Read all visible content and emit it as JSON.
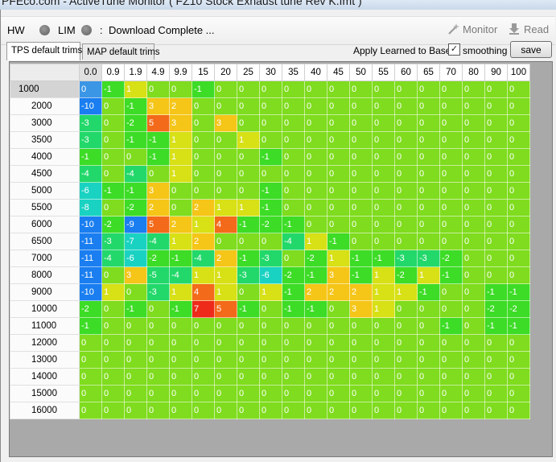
{
  "window": {
    "title": "PFEco.com - ActiveTune Monitor   ( FZ10 Stock Exhaust tune Rev K.fmt )"
  },
  "toolbar": {
    "hw_label": "HW",
    "lim_label": "LIM",
    "status_separator": ":",
    "status_text": "Download Complete  ...",
    "monitor_label": "Monitor",
    "read_label": "Read"
  },
  "tabs": [
    {
      "label": "TPS default trims",
      "active": true
    },
    {
      "label": "MAP default trims",
      "active": false
    }
  ],
  "options": {
    "apply_label": "Apply Learned to Base:",
    "smoothing_checked": true,
    "smoothing_label": "smoothing",
    "save_label": "save"
  },
  "grid": {
    "columns": [
      "0.0",
      "0.9",
      "1.9",
      "4.9",
      "9.9",
      "15",
      "20",
      "25",
      "30",
      "35",
      "40",
      "45",
      "50",
      "55",
      "60",
      "65",
      "70",
      "80",
      "90",
      "100"
    ],
    "rows": [
      "1000",
      "2000",
      "3000",
      "3500",
      "4000",
      "4500",
      "5000",
      "5500",
      "6000",
      "6500",
      "7000",
      "8000",
      "9000",
      "10000",
      "11000",
      "12000",
      "13000",
      "14000",
      "15000",
      "16000"
    ],
    "values": [
      [
        0,
        -1,
        1,
        0,
        0,
        -1,
        0,
        0,
        0,
        0,
        0,
        0,
        0,
        0,
        0,
        0,
        0,
        0,
        0,
        0
      ],
      [
        -10,
        0,
        -1,
        3,
        2,
        0,
        0,
        0,
        0,
        0,
        0,
        0,
        0,
        0,
        0,
        0,
        0,
        0,
        0,
        0
      ],
      [
        -3,
        0,
        -2,
        5,
        3,
        0,
        3,
        0,
        0,
        0,
        0,
        0,
        0,
        0,
        0,
        0,
        0,
        0,
        0,
        0
      ],
      [
        -3,
        0,
        -1,
        -1,
        1,
        0,
        0,
        1,
        0,
        0,
        0,
        0,
        0,
        0,
        0,
        0,
        0,
        0,
        0,
        0
      ],
      [
        -1,
        0,
        0,
        -1,
        1,
        0,
        0,
        0,
        -1,
        0,
        0,
        0,
        0,
        0,
        0,
        0,
        0,
        0,
        0,
        0
      ],
      [
        -4,
        0,
        -4,
        0,
        1,
        0,
        0,
        0,
        0,
        0,
        0,
        0,
        0,
        0,
        0,
        0,
        0,
        0,
        0,
        0
      ],
      [
        -6,
        -1,
        -1,
        3,
        0,
        0,
        0,
        0,
        -1,
        0,
        0,
        0,
        0,
        0,
        0,
        0,
        0,
        0,
        0,
        0
      ],
      [
        -8,
        0,
        -2,
        2,
        0,
        2,
        1,
        1,
        -1,
        0,
        0,
        0,
        0,
        0,
        0,
        0,
        0,
        0,
        0,
        0
      ],
      [
        -10,
        -2,
        -9,
        5,
        2,
        1,
        4,
        -1,
        -2,
        -1,
        0,
        0,
        0,
        0,
        0,
        0,
        0,
        0,
        0,
        0
      ],
      [
        -11,
        -3,
        -7,
        -4,
        1,
        2,
        0,
        0,
        0,
        -4,
        1,
        -1,
        0,
        0,
        0,
        0,
        0,
        0,
        0,
        0
      ],
      [
        -11,
        -4,
        -6,
        -2,
        -1,
        -4,
        2,
        -1,
        -3,
        0,
        -2,
        1,
        -1,
        -1,
        -3,
        -3,
        -2,
        0,
        0,
        0
      ],
      [
        -11,
        0,
        3,
        -5,
        -4,
        1,
        1,
        -3,
        -6,
        -2,
        -1,
        3,
        -1,
        1,
        -2,
        1,
        -1,
        0,
        0,
        0
      ],
      [
        -10,
        1,
        0,
        -3,
        1,
        4,
        1,
        0,
        1,
        -1,
        2,
        2,
        2,
        1,
        1,
        -1,
        0,
        0,
        -1,
        -1
      ],
      [
        -2,
        0,
        -1,
        0,
        -1,
        7,
        5,
        -1,
        0,
        -1,
        -1,
        0,
        3,
        1,
        0,
        0,
        0,
        0,
        -2,
        -2
      ],
      [
        -1,
        0,
        0,
        0,
        0,
        0,
        0,
        0,
        0,
        0,
        0,
        0,
        0,
        0,
        0,
        0,
        -1,
        0,
        -1,
        -1
      ],
      [
        0,
        0,
        0,
        0,
        0,
        0,
        0,
        0,
        0,
        0,
        0,
        0,
        0,
        0,
        0,
        0,
        0,
        0,
        0,
        0
      ],
      [
        0,
        0,
        0,
        0,
        0,
        0,
        0,
        0,
        0,
        0,
        0,
        0,
        0,
        0,
        0,
        0,
        0,
        0,
        0,
        0
      ],
      [
        0,
        0,
        0,
        0,
        0,
        0,
        0,
        0,
        0,
        0,
        0,
        0,
        0,
        0,
        0,
        0,
        0,
        0,
        0,
        0
      ],
      [
        0,
        0,
        0,
        0,
        0,
        0,
        0,
        0,
        0,
        0,
        0,
        0,
        0,
        0,
        0,
        0,
        0,
        0,
        0,
        0
      ],
      [
        0,
        0,
        0,
        0,
        0,
        0,
        0,
        0,
        0,
        0,
        0,
        0,
        0,
        0,
        0,
        0,
        0,
        0,
        0,
        0
      ]
    ],
    "selected_cell_color": "#3c96e6",
    "color_scale": {
      "zero": "#7fdc1e",
      "positive_low": "#d8e016",
      "positive_mid": "#f5c518",
      "positive_high": "#f36a1a",
      "positive_max": "#ee2a1a",
      "negative_low": "#3ddc26",
      "negative_mid": "#22d86a",
      "negative_high": "#1ad2c2",
      "negative_max": "#1a7ef0"
    }
  }
}
